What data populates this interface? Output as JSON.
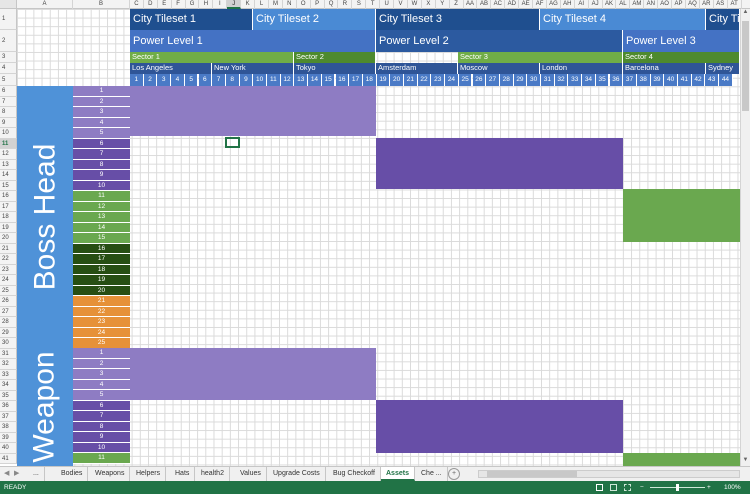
{
  "columns": [
    "A",
    "B",
    "C",
    "D",
    "E",
    "F",
    "G",
    "H",
    "I",
    "J",
    "K",
    "L",
    "M",
    "N",
    "O",
    "P",
    "Q",
    "R",
    "S",
    "T",
    "U",
    "V",
    "W",
    "X",
    "Y",
    "Z",
    "AA",
    "AB",
    "AC",
    "AD",
    "AE",
    "AF",
    "AG",
    "AH",
    "AI",
    "AJ",
    "AK",
    "AL",
    "AM",
    "AN",
    "AO",
    "AP",
    "AQ",
    "AR",
    "AS",
    "AT"
  ],
  "selected_column": "J",
  "selected_row": "11",
  "tilesets": [
    "City Tileset 1",
    "City Tileset 2",
    "City Tileset 3",
    "City Tileset 4",
    "City Ti"
  ],
  "power_levels": [
    "Power Level 1",
    "Power Level 2",
    "Power Level 3"
  ],
  "sectors": [
    "Sector 1",
    "Sector 2",
    "Sector 3",
    "Sector 4"
  ],
  "cities": [
    "Los Angeles",
    "New York",
    "Tokyo",
    "Amsterdam",
    "Moscow",
    "London",
    "Barcelona",
    "Sydney"
  ],
  "numbers": [
    "1",
    "2",
    "3",
    "4",
    "5",
    "6",
    "7",
    "8",
    "9",
    "10",
    "11",
    "12",
    "13",
    "14",
    "15",
    "16",
    "17",
    "18",
    "19",
    "20",
    "21",
    "22",
    "23",
    "24",
    "25",
    "26",
    "27",
    "28",
    "29",
    "30",
    "31",
    "32",
    "33",
    "34",
    "35",
    "36",
    "37",
    "38",
    "39",
    "40",
    "41",
    "42",
    "43",
    "44"
  ],
  "rows": [
    "5",
    "6",
    "7",
    "8",
    "9",
    "10",
    "11",
    "12",
    "13",
    "14",
    "15",
    "16",
    "17",
    "18",
    "19",
    "20",
    "21",
    "22",
    "23",
    "24",
    "25",
    "26",
    "27",
    "28",
    "29",
    "30",
    "31",
    "32",
    "33",
    "34",
    "35",
    "36",
    "37",
    "38",
    "39",
    "40",
    "41"
  ],
  "boss_head_label": "Boss Head",
  "weapon_label": "Weapon",
  "boss_head_indices": [
    "1",
    "2",
    "3",
    "4",
    "5",
    "6",
    "7",
    "8",
    "9",
    "10",
    "11",
    "12",
    "13",
    "14",
    "15",
    "16",
    "17",
    "18",
    "19",
    "20",
    "21",
    "22",
    "23",
    "24",
    "25"
  ],
  "weapon_indices": [
    "1",
    "2",
    "3",
    "4",
    "5",
    "6",
    "7",
    "8",
    "9",
    "10",
    "11"
  ],
  "colors": {
    "tileset_dark": "#1f4f8f",
    "tileset_light": "#4a8ad4",
    "power_light": "#4472c4",
    "power_dark": "#2c5aa0",
    "sector_green": "#70ad47",
    "sector_dark_green": "#4e8a2e",
    "city_blue": "#2f5597",
    "lavender": "#8e7cc3",
    "purple": "#674ea7",
    "green": "#6aa84f",
    "dark_green": "#274e13",
    "orange": "#e69138",
    "label_blue": "#4f92d8"
  },
  "tabs": [
    "...",
    "Bodies",
    "Weapons",
    "Helpers",
    "Hats",
    "health2",
    "Values",
    "Upgrade Costs",
    "Bug Checkoff",
    "Assets",
    "Che ..."
  ],
  "active_tab": "Assets",
  "status": {
    "ready": "READY",
    "zoom": "100%"
  }
}
